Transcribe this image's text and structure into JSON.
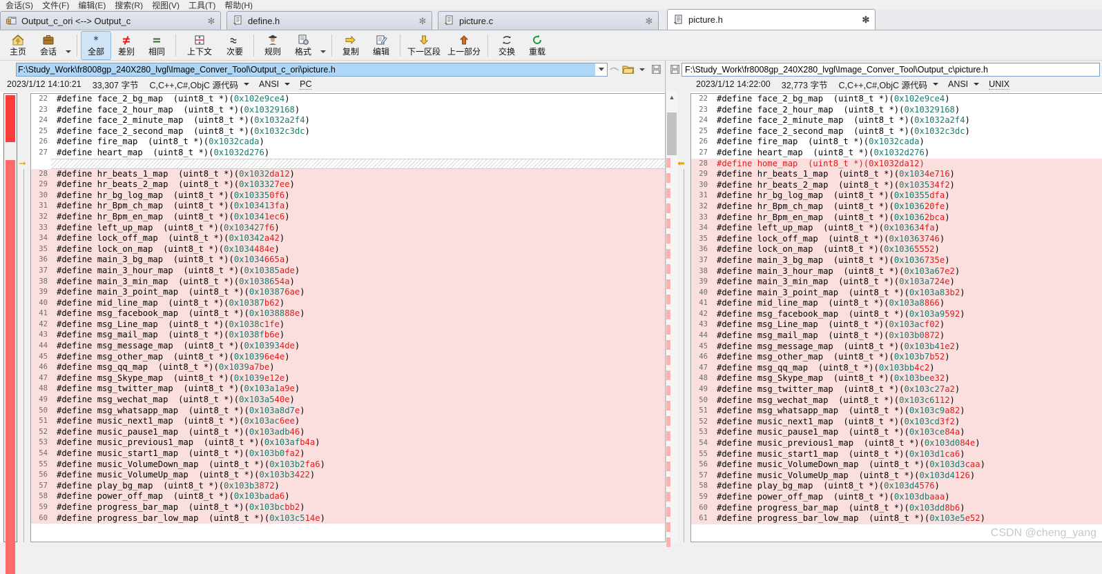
{
  "menu": {
    "items": [
      "会话(S)",
      "文件(F)",
      "编辑(E)",
      "搜索(R)",
      "视图(V)",
      "工具(T)",
      "帮助(H)"
    ]
  },
  "tabs": [
    {
      "label": "Output_c_ori <--> Output_c",
      "icon": "compare-folders-icon",
      "close": "✻",
      "active": false
    },
    {
      "label": "define.h",
      "icon": "document-icon",
      "close": "✻",
      "active": false
    },
    {
      "label": "picture.c",
      "icon": "document-icon",
      "close": "✻",
      "active": false
    },
    {
      "label": "picture.h",
      "icon": "document-icon",
      "close": "✻",
      "active": true
    }
  ],
  "toolbar": {
    "buttons": [
      {
        "label": "主页",
        "icon": "home-icon",
        "selected": false,
        "dropdown": false
      },
      {
        "label": "会话",
        "icon": "briefcase-icon",
        "selected": false,
        "dropdown": true
      },
      {
        "label": "全部",
        "icon": "asterisk-icon",
        "selected": true,
        "dropdown": false
      },
      {
        "label": "差别",
        "icon": "not-equal-icon",
        "selected": false,
        "dropdown": false
      },
      {
        "label": "相同",
        "icon": "equal-icon",
        "selected": false,
        "dropdown": false
      },
      {
        "label": "上下文",
        "icon": "context-icon",
        "selected": false,
        "dropdown": false
      },
      {
        "label": "次要",
        "icon": "approx-icon",
        "selected": false,
        "dropdown": false
      },
      {
        "label": "规则",
        "icon": "detective-icon",
        "selected": false,
        "dropdown": false
      },
      {
        "label": "格式",
        "icon": "format-gear-icon",
        "selected": false,
        "dropdown": true
      },
      {
        "label": "复制",
        "icon": "arrow-right-icon",
        "selected": false,
        "dropdown": false
      },
      {
        "label": "编辑",
        "icon": "pencil-note-icon",
        "selected": false,
        "dropdown": false
      },
      {
        "label": "下一区段",
        "icon": "arrow-down-icon",
        "selected": false,
        "dropdown": false
      },
      {
        "label": "上一部分",
        "icon": "arrow-up-icon",
        "selected": false,
        "dropdown": false
      },
      {
        "label": "交换",
        "icon": "swap-icon",
        "selected": false,
        "dropdown": false
      },
      {
        "label": "重载",
        "icon": "reload-icon",
        "selected": false,
        "dropdown": false
      }
    ]
  },
  "left_pane": {
    "path": "F:\\Study_Work\\fr8008gp_240X280_lvgl\\Image_Conver_Tool\\Output_c_ori\\picture.h",
    "path_selected": true,
    "dropdown_icon": "chevron-down-icon",
    "browse_icon": "open-folder-icon",
    "goto_icon": "goto-icon",
    "save_icon": "save-icon",
    "info": {
      "timestamp": "2023/1/12 14:10:21",
      "size": "33,307 字节",
      "syntax": "C,C++,C#,ObjC 源代码",
      "encoding": "ANSI",
      "line_ending": "PC"
    },
    "lines": [
      {
        "n": "22",
        "name": "face_2_bg_map",
        "addr": "0x102e9ce4",
        "diff": false,
        "ins": false,
        "redfrom": -1
      },
      {
        "n": "23",
        "name": "face_2_hour_map",
        "addr": "0x10329168",
        "diff": false,
        "ins": false,
        "redfrom": -1
      },
      {
        "n": "24",
        "name": "face_2_minute_map",
        "addr": "0x1032a2f4",
        "diff": false,
        "ins": false,
        "redfrom": -1
      },
      {
        "n": "25",
        "name": "face_2_second_map",
        "addr": "0x1032c3dc",
        "diff": false,
        "ins": false,
        "redfrom": -1
      },
      {
        "n": "26",
        "name": "fire_map",
        "addr": "0x1032cada",
        "diff": false,
        "ins": false,
        "redfrom": -1
      },
      {
        "n": "27",
        "name": "heart_map",
        "addr": "0x1032d276",
        "diff": false,
        "ins": false,
        "redfrom": -1
      },
      {
        "n": "28",
        "name": "hr_beats_1_map",
        "addr": "0x1032da12",
        "diff": true,
        "ins": false,
        "redfrom": 6
      },
      {
        "n": "29",
        "name": "hr_beats_2_map",
        "addr": "0x103327ee",
        "diff": true,
        "ins": false,
        "redfrom": 7
      },
      {
        "n": "30",
        "name": "hr_bg_log_map",
        "addr": "0x103350f6",
        "diff": true,
        "ins": false,
        "redfrom": 7
      },
      {
        "n": "31",
        "name": "hr_Bpm_ch_map",
        "addr": "0x103413fa",
        "diff": true,
        "ins": false,
        "redfrom": 7
      },
      {
        "n": "32",
        "name": "hr_Bpm_en_map",
        "addr": "0x10341ec6",
        "diff": true,
        "ins": false,
        "redfrom": 6
      },
      {
        "n": "33",
        "name": "left_up_map",
        "addr": "0x103427f6",
        "diff": true,
        "ins": false,
        "redfrom": 8
      },
      {
        "n": "34",
        "name": "lock_off_map",
        "addr": "0x10342a42",
        "diff": true,
        "ins": false,
        "redfrom": 7
      },
      {
        "n": "35",
        "name": "lock_on_map",
        "addr": "0x1034484e",
        "diff": true,
        "ins": false,
        "redfrom": 6
      },
      {
        "n": "36",
        "name": "main_3_bg_map",
        "addr": "0x1034665a",
        "diff": true,
        "ins": false,
        "redfrom": 6
      },
      {
        "n": "37",
        "name": "main_3_hour_map",
        "addr": "0x10385ade",
        "diff": true,
        "ins": false,
        "redfrom": 7
      },
      {
        "n": "38",
        "name": "main_3_min_map",
        "addr": "0x1038654a",
        "diff": true,
        "ins": false,
        "redfrom": 7
      },
      {
        "n": "39",
        "name": "main_3_point_map",
        "addr": "0x103876ae",
        "diff": true,
        "ins": false,
        "redfrom": 7
      },
      {
        "n": "40",
        "name": "mid_line_map",
        "addr": "0x10387b62",
        "diff": true,
        "ins": false,
        "redfrom": 7
      },
      {
        "n": "41",
        "name": "msg_facebook_map",
        "addr": "0x1038888e",
        "diff": true,
        "ins": false,
        "redfrom": 7
      },
      {
        "n": "42",
        "name": "msg_Line_map",
        "addr": "0x1038c1fe",
        "diff": true,
        "ins": false,
        "redfrom": 7
      },
      {
        "n": "43",
        "name": "msg_mail_map",
        "addr": "0x1038fb6e",
        "diff": true,
        "ins": false,
        "redfrom": 7
      },
      {
        "n": "44",
        "name": "msg_message_map",
        "addr": "0x103934de",
        "diff": true,
        "ins": false,
        "redfrom": 7
      },
      {
        "n": "45",
        "name": "msg_other_map",
        "addr": "0x10396e4e",
        "diff": true,
        "ins": false,
        "redfrom": 6
      },
      {
        "n": "46",
        "name": "msg_qq_map",
        "addr": "0x1039a7be",
        "diff": true,
        "ins": false,
        "redfrom": 6
      },
      {
        "n": "47",
        "name": "msg_Skype_map",
        "addr": "0x1039e12e",
        "diff": true,
        "ins": false,
        "redfrom": 6
      },
      {
        "n": "48",
        "name": "msg_twitter_map",
        "addr": "0x103a1a9e",
        "diff": true,
        "ins": false,
        "redfrom": 7
      },
      {
        "n": "49",
        "name": "msg_wechat_map",
        "addr": "0x103a540e",
        "diff": true,
        "ins": false,
        "redfrom": 7
      },
      {
        "n": "50",
        "name": "msg_whatsapp_map",
        "addr": "0x103a8d7e",
        "diff": true,
        "ins": false,
        "redfrom": 9
      },
      {
        "n": "51",
        "name": "music_next1_map",
        "addr": "0x103ac6ee",
        "diff": true,
        "ins": false,
        "redfrom": 7
      },
      {
        "n": "52",
        "name": "music_pause1_map",
        "addr": "0x103adb46",
        "diff": true,
        "ins": false,
        "redfrom": 8
      },
      {
        "n": "53",
        "name": "music_previous1_map",
        "addr": "0x103afb4a",
        "diff": true,
        "ins": false,
        "redfrom": 7
      },
      {
        "n": "54",
        "name": "music_start1_map",
        "addr": "0x103b0fa2",
        "diff": true,
        "ins": false,
        "redfrom": 7
      },
      {
        "n": "55",
        "name": "music_VolumeDown_map",
        "addr": "0x103b2fa6",
        "diff": true,
        "ins": false,
        "redfrom": 7
      },
      {
        "n": "56",
        "name": "music_VolumeUp_map",
        "addr": "0x103b3422",
        "diff": true,
        "ins": false,
        "redfrom": 7
      },
      {
        "n": "57",
        "name": "play_bg_map",
        "addr": "0x103b3872",
        "diff": true,
        "ins": false,
        "redfrom": 7
      },
      {
        "n": "58",
        "name": "power_off_map",
        "addr": "0x103bada6",
        "diff": true,
        "ins": false,
        "redfrom": 7
      },
      {
        "n": "59",
        "name": "progress_bar_map",
        "addr": "0x103bcbb2",
        "diff": true,
        "ins": false,
        "redfrom": 7
      },
      {
        "n": "60",
        "name": "progress_bar_low_map",
        "addr": "0x103c514e",
        "diff": true,
        "ins": false,
        "redfrom": 7
      }
    ]
  },
  "right_pane": {
    "path": "F:\\Study_Work\\fr8008gp_240X280_lvgl\\Image_Conver_Tool\\Output_c\\picture.h",
    "path_selected": false,
    "save_icon": "save-icon",
    "info": {
      "timestamp": "2023/1/12 14:22:00",
      "size": "32,773 字节",
      "syntax": "C,C++,C#,ObjC 源代码",
      "encoding": "ANSI",
      "line_ending": "UNIX"
    },
    "lines": [
      {
        "n": "22",
        "name": "face_2_bg_map",
        "addr": "0x102e9ce4",
        "diff": false,
        "ins": false,
        "redfrom": -1
      },
      {
        "n": "23",
        "name": "face_2_hour_map",
        "addr": "0x10329168",
        "diff": false,
        "ins": false,
        "redfrom": -1
      },
      {
        "n": "24",
        "name": "face_2_minute_map",
        "addr": "0x1032a2f4",
        "diff": false,
        "ins": false,
        "redfrom": -1
      },
      {
        "n": "25",
        "name": "face_2_second_map",
        "addr": "0x1032c3dc",
        "diff": false,
        "ins": false,
        "redfrom": -1
      },
      {
        "n": "26",
        "name": "fire_map",
        "addr": "0x1032cada",
        "diff": false,
        "ins": false,
        "redfrom": -1
      },
      {
        "n": "27",
        "name": "heart_map",
        "addr": "0x1032d276",
        "diff": false,
        "ins": false,
        "redfrom": -1
      },
      {
        "n": "28",
        "name": "home_map",
        "addr": "0x1032da12",
        "diff": true,
        "ins": true,
        "redfrom": 0
      },
      {
        "n": "29",
        "name": "hr_beats_1_map",
        "addr": "0x1034e716",
        "diff": true,
        "ins": false,
        "redfrom": 5
      },
      {
        "n": "30",
        "name": "hr_beats_2_map",
        "addr": "0x103534f2",
        "diff": true,
        "ins": false,
        "redfrom": 6
      },
      {
        "n": "31",
        "name": "hr_bg_log_map",
        "addr": "0x10355dfa",
        "diff": true,
        "ins": false,
        "redfrom": 7
      },
      {
        "n": "32",
        "name": "hr_Bpm_ch_map",
        "addr": "0x103620fe",
        "diff": true,
        "ins": false,
        "redfrom": 6
      },
      {
        "n": "33",
        "name": "hr_Bpm_en_map",
        "addr": "0x10362bca",
        "diff": true,
        "ins": false,
        "redfrom": 6
      },
      {
        "n": "34",
        "name": "left_up_map",
        "addr": "0x103634fa",
        "diff": true,
        "ins": false,
        "redfrom": 7
      },
      {
        "n": "35",
        "name": "lock_off_map",
        "addr": "0x10363746",
        "diff": true,
        "ins": false,
        "redfrom": 6
      },
      {
        "n": "36",
        "name": "lock_on_map",
        "addr": "0x10365552",
        "diff": true,
        "ins": false,
        "redfrom": 6
      },
      {
        "n": "37",
        "name": "main_3_bg_map",
        "addr": "0x1036735e",
        "diff": true,
        "ins": false,
        "redfrom": 6
      },
      {
        "n": "38",
        "name": "main_3_hour_map",
        "addr": "0x103a67e2",
        "diff": true,
        "ins": false,
        "redfrom": 7
      },
      {
        "n": "39",
        "name": "main_3_min_map",
        "addr": "0x103a724e",
        "diff": true,
        "ins": false,
        "redfrom": 7
      },
      {
        "n": "40",
        "name": "main_3_point_map",
        "addr": "0x103a83b2",
        "diff": true,
        "ins": false,
        "redfrom": 7
      },
      {
        "n": "41",
        "name": "mid_line_map",
        "addr": "0x103a8866",
        "diff": true,
        "ins": false,
        "redfrom": 7
      },
      {
        "n": "42",
        "name": "msg_facebook_map",
        "addr": "0x103a9592",
        "diff": true,
        "ins": false,
        "redfrom": 7
      },
      {
        "n": "43",
        "name": "msg_Line_map",
        "addr": "0x103acf02",
        "diff": true,
        "ins": false,
        "redfrom": 7
      },
      {
        "n": "44",
        "name": "msg_mail_map",
        "addr": "0x103b0872",
        "diff": true,
        "ins": false,
        "redfrom": 7
      },
      {
        "n": "45",
        "name": "msg_message_map",
        "addr": "0x103b41e2",
        "diff": true,
        "ins": false,
        "redfrom": 7
      },
      {
        "n": "46",
        "name": "msg_other_map",
        "addr": "0x103b7b52",
        "diff": true,
        "ins": false,
        "redfrom": 7
      },
      {
        "n": "47",
        "name": "msg_qq_map",
        "addr": "0x103bb4c2",
        "diff": true,
        "ins": false,
        "redfrom": 7
      },
      {
        "n": "48",
        "name": "msg_Skype_map",
        "addr": "0x103bee32",
        "diff": true,
        "ins": false,
        "redfrom": 7
      },
      {
        "n": "49",
        "name": "msg_twitter_map",
        "addr": "0x103c27a2",
        "diff": true,
        "ins": false,
        "redfrom": 7
      },
      {
        "n": "50",
        "name": "msg_wechat_map",
        "addr": "0x103c6112",
        "diff": true,
        "ins": false,
        "redfrom": 7
      },
      {
        "n": "51",
        "name": "msg_whatsapp_map",
        "addr": "0x103c9a82",
        "diff": true,
        "ins": false,
        "redfrom": 7
      },
      {
        "n": "52",
        "name": "music_next1_map",
        "addr": "0x103cd3f2",
        "diff": true,
        "ins": false,
        "redfrom": 7
      },
      {
        "n": "53",
        "name": "music_pause1_map",
        "addr": "0x103ce84a",
        "diff": true,
        "ins": false,
        "redfrom": 7
      },
      {
        "n": "54",
        "name": "music_previous1_map",
        "addr": "0x103d084e",
        "diff": true,
        "ins": false,
        "redfrom": 7
      },
      {
        "n": "55",
        "name": "music_start1_map",
        "addr": "0x103d1ca6",
        "diff": true,
        "ins": false,
        "redfrom": 7
      },
      {
        "n": "56",
        "name": "music_VolumeDown_map",
        "addr": "0x103d3caa",
        "diff": true,
        "ins": false,
        "redfrom": 7
      },
      {
        "n": "57",
        "name": "music_VolumeUp_map",
        "addr": "0x103d4126",
        "diff": true,
        "ins": false,
        "redfrom": 7
      },
      {
        "n": "58",
        "name": "play_bg_map",
        "addr": "0x103d4576",
        "diff": true,
        "ins": false,
        "redfrom": 7
      },
      {
        "n": "59",
        "name": "power_off_map",
        "addr": "0x103dbaaa",
        "diff": true,
        "ins": false,
        "redfrom": 7
      },
      {
        "n": "60",
        "name": "progress_bar_map",
        "addr": "0x103dd8b6",
        "diff": true,
        "ins": false,
        "redfrom": 7
      },
      {
        "n": "61",
        "name": "progress_bar_low_map",
        "addr": "0x103e5e52",
        "diff": true,
        "ins": false,
        "redfrom": 7
      }
    ]
  },
  "watermark": "CSDN @cheng_yang",
  "colors": {
    "diff_background": "#fbdede",
    "diff_text": "#e01b1b",
    "number_literal": "#1a7a6d",
    "overview_marker": "#fa3c3c",
    "selection": "#add6f7",
    "toolbar_selected": "#cfe5f7"
  }
}
